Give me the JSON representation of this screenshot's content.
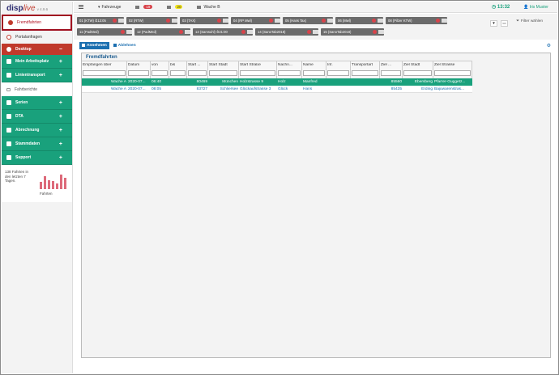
{
  "app": {
    "logo_disp": "disp",
    "logo_live": "live",
    "version": "v 4.9.6"
  },
  "sidebar": {
    "fremdfahrten": "Fremdfahrten",
    "portalanfragen": "Portalanfragen",
    "desktop": "Desktop",
    "desktop_toggle": "−",
    "items": [
      {
        "label": "Mein Arbeitsplatz",
        "toggle": "+"
      },
      {
        "label": "Linientransport",
        "toggle": "+"
      }
    ],
    "fahrberichte": "Fahrberichte",
    "groups": [
      {
        "label": "Serien",
        "toggle": "+"
      },
      {
        "label": "DTA",
        "toggle": "+"
      },
      {
        "label": "Abrechnung",
        "toggle": "+"
      },
      {
        "label": "Stammdaten",
        "toggle": "+"
      },
      {
        "label": "Support",
        "toggle": "+"
      }
    ],
    "stats_text": "138 Fahrten in den letzten 7 Tagen.",
    "stats_label": "Fahrten",
    "stats_bars": [
      0.45,
      0.8,
      0.55,
      0.5,
      0.35,
      0.9,
      0.7
    ]
  },
  "topbar": {
    "fahrzeuge": "Fahrzeuge",
    "badge_red": "19",
    "badge_yellow": "20",
    "wache": "Wache B",
    "time": "13:32",
    "user": "Iris Muster"
  },
  "vehicles_row1": [
    "01 (KTW) ⏱13:05",
    "02 (RTW)",
    "03 (TAX)",
    "04 (RP Mwl)",
    "05 (Hans Tax)",
    "06 (Mwl)",
    "08 (Pilzer KTW)"
  ],
  "vehicles_row2": [
    "11 (PadMed)",
    "12 (PadMed)",
    "13 (Samsuhl) ⏱21:00",
    "14 (SanoTab2018)",
    "15 (SanoTab2018)"
  ],
  "filter_label": "Filter wählen",
  "actions": {
    "accept": "Annehmen",
    "reject": "Ablehnen"
  },
  "panel": {
    "title": "Fremdfahrten",
    "columns": [
      "Empfangen über",
      "Datum",
      "von",
      "bis",
      "Start ...",
      "Start Stadt",
      "Start Straße",
      "Nachn...",
      "Name",
      "Inf.",
      "Transportart",
      "Ziel ...",
      "Ziel Stadt",
      "Ziel Strasse"
    ],
    "rows": [
      [
        "Wache A",
        "2020-07...",
        "06:40",
        "",
        "80469",
        "München",
        "Holzstrasse 9",
        "Holz",
        "Manfred",
        "",
        "",
        "85560",
        "Ebersberg",
        "Pfarrer-Guggetz..."
      ],
      [
        "Wache A",
        "2020-07...",
        "08:05",
        "",
        "83727",
        "Schliersee",
        "Glückaufstrasse 3",
        "Glück",
        "Hans",
        "",
        "",
        "85435",
        "Erding",
        "Bajuwarenstras..."
      ]
    ]
  }
}
